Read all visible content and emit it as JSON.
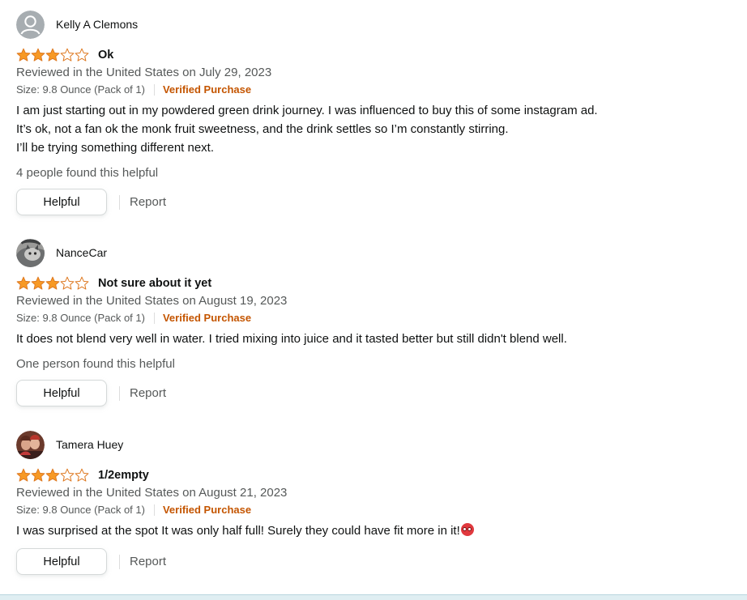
{
  "reviews": [
    {
      "reviewer": "Kelly A Clemons",
      "avatar": "default-avatar",
      "rating": 3,
      "title": "Ok",
      "date": "Reviewed in the United States on July 29, 2023",
      "size": "Size: 9.8 Ounce (Pack of 1)",
      "verified": "Verified Purchase",
      "body": [
        "I am just starting out in my powdered green drink journey. I was influenced to buy this of some instagram ad.",
        "It’s ok, not a fan ok the monk fruit sweetness, and the drink settles so I’m constantly stirring.",
        "I’ll be trying something different next."
      ],
      "helpful_count": "4 people found this helpful",
      "helpful_label": "Helpful",
      "report_label": "Report"
    },
    {
      "reviewer": "NanceCar",
      "avatar": "cat-photo-avatar",
      "rating": 3,
      "title": "Not sure about it yet",
      "date": "Reviewed in the United States on August 19, 2023",
      "size": "Size: 9.8 Ounce (Pack of 1)",
      "verified": "Verified Purchase",
      "body": [
        "It does not blend very well in water. I tried mixing into juice and it tasted better but still didn't blend well."
      ],
      "helpful_count": "One person found this helpful",
      "helpful_label": "Helpful",
      "report_label": "Report"
    },
    {
      "reviewer": "Tamera Huey",
      "avatar": "person-photo-avatar",
      "rating": 3,
      "title": "1/2empty",
      "date": "Reviewed in the United States on August 21, 2023",
      "size": "Size: 9.8 Ounce (Pack of 1)",
      "verified": "Verified Purchase",
      "body": [
        "I was surprised at the spot It was only half full! Surely they could have fit more in it!"
      ],
      "body_emoji": "surprised-face-emoji",
      "helpful_count": "",
      "helpful_label": "Helpful",
      "report_label": "Report"
    }
  ],
  "colors": {
    "star_filled": "#f79925",
    "star_outline": "#de7921",
    "verified": "#c45500",
    "muted_text": "#565959"
  }
}
